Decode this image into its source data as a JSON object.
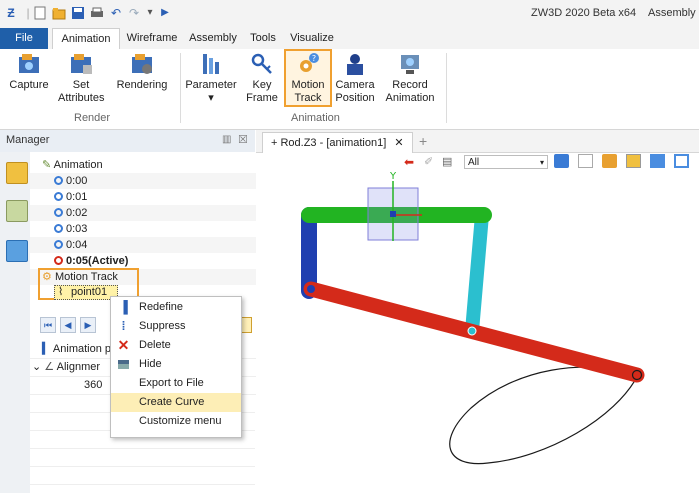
{
  "app": {
    "title": "ZW3D 2020 Beta x64",
    "document": "Assembly |",
    "quick_access_icons": [
      "app-logo-icon",
      "new-icon",
      "open-icon",
      "save-icon",
      "print-icon",
      "undo-icon",
      "redo-icon",
      "customize-icon",
      "play-icon"
    ]
  },
  "menu": {
    "tabs": [
      "File",
      "Animation",
      "Wireframe",
      "Assembly",
      "Tools",
      "Visualize"
    ],
    "active": "Animation"
  },
  "ribbon": {
    "groups": [
      {
        "label": "Render",
        "buttons": [
          {
            "label": "Capture",
            "icon": "capture-icon"
          },
          {
            "label": "Set\nAttributes",
            "icon": "set-attributes-icon"
          },
          {
            "label": "Rendering",
            "icon": "rendering-icon"
          }
        ]
      },
      {
        "label": "Animation",
        "buttons": [
          {
            "label": "Parameter\n▾",
            "icon": "parameter-icon"
          },
          {
            "label": "Key\nFrame",
            "icon": "key-frame-icon"
          },
          {
            "label": "Motion\nTrack",
            "icon": "motion-track-icon",
            "highlighted": true
          },
          {
            "label": "Camera\nPosition",
            "icon": "camera-position-icon"
          },
          {
            "label": "Record\nAnimation",
            "icon": "record-animation-icon"
          }
        ]
      }
    ]
  },
  "manager": {
    "title": "Manager",
    "tree": {
      "root": "Animation",
      "keyframes": [
        "0:00",
        "0:01",
        "0:02",
        "0:03",
        "0:04"
      ],
      "active_keyframe": "0:05(Active)",
      "motion_track": "Motion Track",
      "point": "point01"
    },
    "playback_icons": [
      "rewind-start-icon",
      "step-back-icon",
      "play-icon"
    ],
    "properties": {
      "header": "Animation p",
      "item": "Alignmer",
      "value": "360"
    }
  },
  "context_menu": {
    "items": [
      {
        "label": "Redefine",
        "icon": "redefine-icon"
      },
      {
        "label": "Suppress",
        "icon": "suppress-icon"
      },
      {
        "label": "Delete",
        "icon": "delete-icon"
      },
      {
        "label": "Hide",
        "icon": "hide-icon"
      },
      {
        "label": "Export to File",
        "icon": ""
      },
      {
        "label": "Create Curve",
        "icon": "",
        "highlighted": true
      },
      {
        "label": "Customize menu",
        "icon": ""
      }
    ]
  },
  "viewport": {
    "tab_label": "+ Rod.Z3 - [animation1]",
    "close_glyph": "✕",
    "add_tab_glyph": "+",
    "filter_value": "All",
    "axis_label": "Y",
    "colors": {
      "green_link": "#22b422",
      "blue_link": "#1f3fb0",
      "cyan_link": "#2bbfcf",
      "red_link": "#d42a1a",
      "highlight_orange": "#f0a030"
    }
  }
}
